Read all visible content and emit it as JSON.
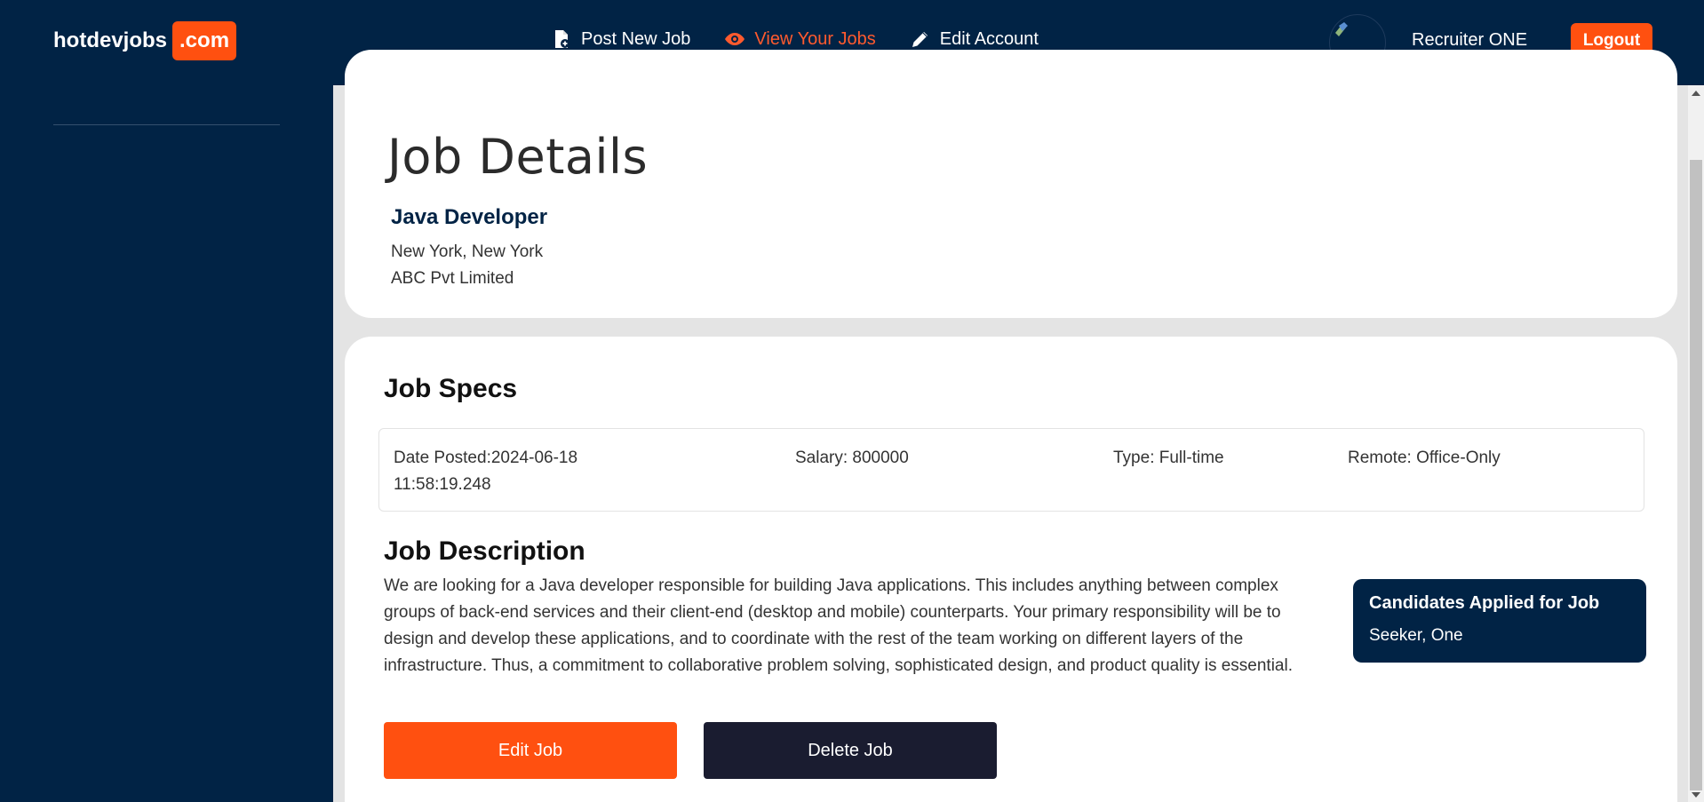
{
  "navbar": {
    "brand_name": "hotdevjobs",
    "brand_suffix": ".com",
    "links": [
      {
        "label": "Post New Job",
        "icon": "file-plus-icon"
      },
      {
        "label": "View Your Jobs",
        "icon": "eye-icon"
      },
      {
        "label": "Edit Account",
        "icon": "pencil-icon"
      }
    ],
    "user_name": "Recruiter ONE",
    "logout_label": "Logout"
  },
  "job": {
    "page_title": "Job Details",
    "title": "Java Developer",
    "location": "New York, New York",
    "company": "ABC Pvt Limited"
  },
  "specs": {
    "heading": "Job Specs",
    "date_posted": "Date Posted:2024-06-18 11:58:19.248",
    "salary": "Salary: 800000",
    "type": "Type: Full-time",
    "remote": "Remote: Office-Only"
  },
  "description": {
    "heading": "Job Description",
    "text": "We are looking for a Java developer responsible for building Java applications. This includes anything between complex groups of back-end services and their client-end (desktop and mobile) counterparts. Your primary responsibility will be to design and develop these applications, and to coordinate with the rest of the team working on different layers of the infrastructure. Thus, a commitment to collaborative problem solving, sophisticated design, and product quality is essential."
  },
  "actions": {
    "edit_label": "Edit Job",
    "delete_label": "Delete Job"
  },
  "candidates": {
    "heading": "Candidates Applied for Job",
    "items": [
      "Seeker, One"
    ]
  },
  "colors": {
    "navy": "#012345",
    "accent": "#FF5010",
    "dark_button": "#1a1c30"
  }
}
